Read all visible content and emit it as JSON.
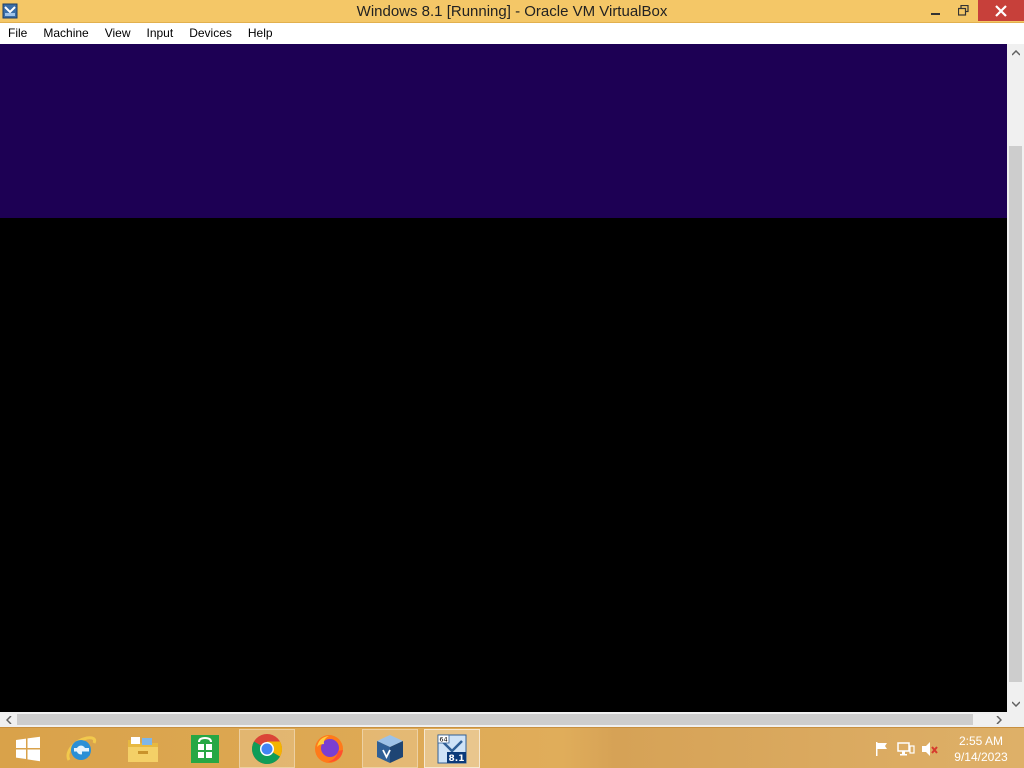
{
  "window": {
    "title": "Windows 8.1 [Running] - Oracle VM VirtualBox",
    "icons": {
      "app": "virtualbox-vm-icon",
      "minimize": "minimize-icon",
      "restore": "restore-icon",
      "close": "close-icon"
    }
  },
  "menu": {
    "items": [
      {
        "label": "File"
      },
      {
        "label": "Machine"
      },
      {
        "label": "View"
      },
      {
        "label": "Input"
      },
      {
        "label": "Devices"
      },
      {
        "label": "Help"
      }
    ]
  },
  "vm": {
    "top_color": "#1d0054",
    "bottom_color": "#000000"
  },
  "taskbar": {
    "apps": [
      {
        "name": "start-button",
        "icon": "windows-logo-icon"
      },
      {
        "name": "internet-explorer",
        "icon": "ie-icon"
      },
      {
        "name": "file-explorer",
        "icon": "folder-icon"
      },
      {
        "name": "store",
        "icon": "store-icon"
      },
      {
        "name": "chrome",
        "icon": "chrome-icon"
      },
      {
        "name": "firefox",
        "icon": "firefox-icon"
      },
      {
        "name": "virtualbox",
        "icon": "virtualbox-icon"
      },
      {
        "name": "windows-8-1-vm",
        "icon": "windows-8-1-vm-icon",
        "badge_top": "64",
        "badge_main": "8.1"
      }
    ],
    "tray": {
      "icons": [
        "flag-icon",
        "network-icon",
        "speaker-muted-icon"
      ],
      "time": "2:55 AM",
      "date": "9/14/2023"
    }
  }
}
